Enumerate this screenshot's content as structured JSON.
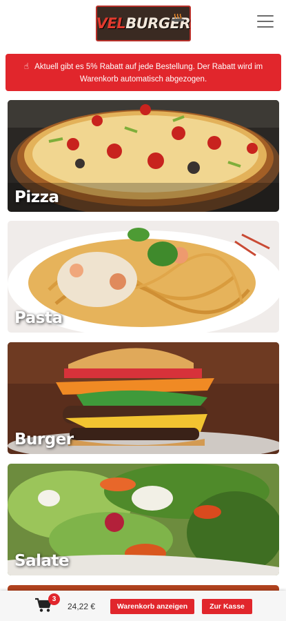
{
  "header": {
    "logo_part1": "VEL",
    "logo_part2": "BURGER",
    "menu_icon": "hamburger-menu-icon"
  },
  "notice": {
    "icon": "pointing-hand-icon",
    "text": "Aktuell gibt es 5% Rabatt auf jede Bestellung. Der Rabatt wird im Warenkorb automatisch abgezogen."
  },
  "categories": [
    {
      "label": "Pizza"
    },
    {
      "label": "Pasta"
    },
    {
      "label": "Burger"
    },
    {
      "label": "Salate"
    }
  ],
  "cart": {
    "icon": "shopping-cart-icon",
    "count": "3",
    "total": "24,22 €",
    "view_cart_label": "Warenkorb anzeigen",
    "checkout_label": "Zur Kasse"
  },
  "colors": {
    "accent": "#e1262c",
    "logo_bg": "#3a2a22"
  }
}
